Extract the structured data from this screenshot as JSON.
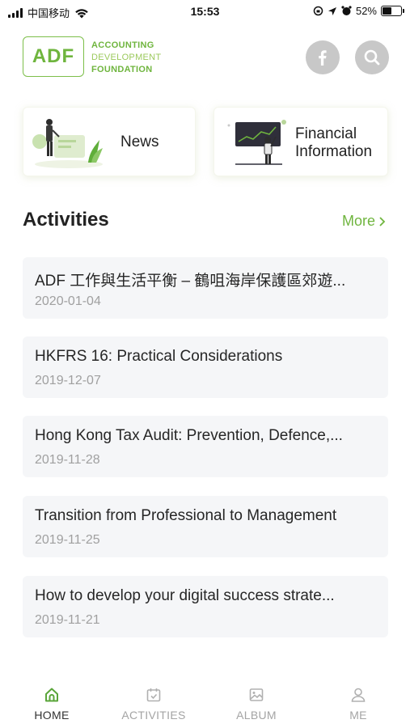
{
  "status_bar": {
    "carrier": "中国移动",
    "time": "15:53",
    "battery": "52%",
    "battery_level": 0.52
  },
  "header": {
    "logo_abbr": "ADF",
    "logo_lines": [
      "ACCOUNTING",
      "DEVELOPMENT",
      "FOUNDATION"
    ],
    "icons": [
      "facebook-icon",
      "search-icon"
    ]
  },
  "cards": {
    "news_label": "News",
    "financial_label_1": "Financial",
    "financial_label_2": "Information"
  },
  "activities": {
    "title": "Activities",
    "more_label": "More",
    "items": [
      {
        "title": "ADF 工作與生活平衡 – 鶴咀海岸保護區郊遊...",
        "date": "2020-01-04"
      },
      {
        "title": "HKFRS 16: Practical Considerations",
        "date": "2019-12-07"
      },
      {
        "title": "Hong Kong Tax Audit: Prevention, Defence,...",
        "date": "2019-11-28"
      },
      {
        "title": "Transition from Professional to Management",
        "date": "2019-11-25"
      },
      {
        "title": "How to develop your digital success strate...",
        "date": "2019-11-21"
      }
    ]
  },
  "tab_bar": {
    "tabs": [
      {
        "label": "HOME",
        "icon": "home-icon",
        "active": true
      },
      {
        "label": "ACTIVITIES",
        "icon": "calendar-icon",
        "active": false
      },
      {
        "label": "ALBUM",
        "icon": "image-icon",
        "active": false
      },
      {
        "label": "ME",
        "icon": "user-icon",
        "active": false
      }
    ]
  },
  "colors": {
    "brand_green": "#6fb53e",
    "list_bg": "#f5f6f8",
    "muted_text": "#a0a0a0",
    "icon_circle": "#c8c8c8"
  }
}
